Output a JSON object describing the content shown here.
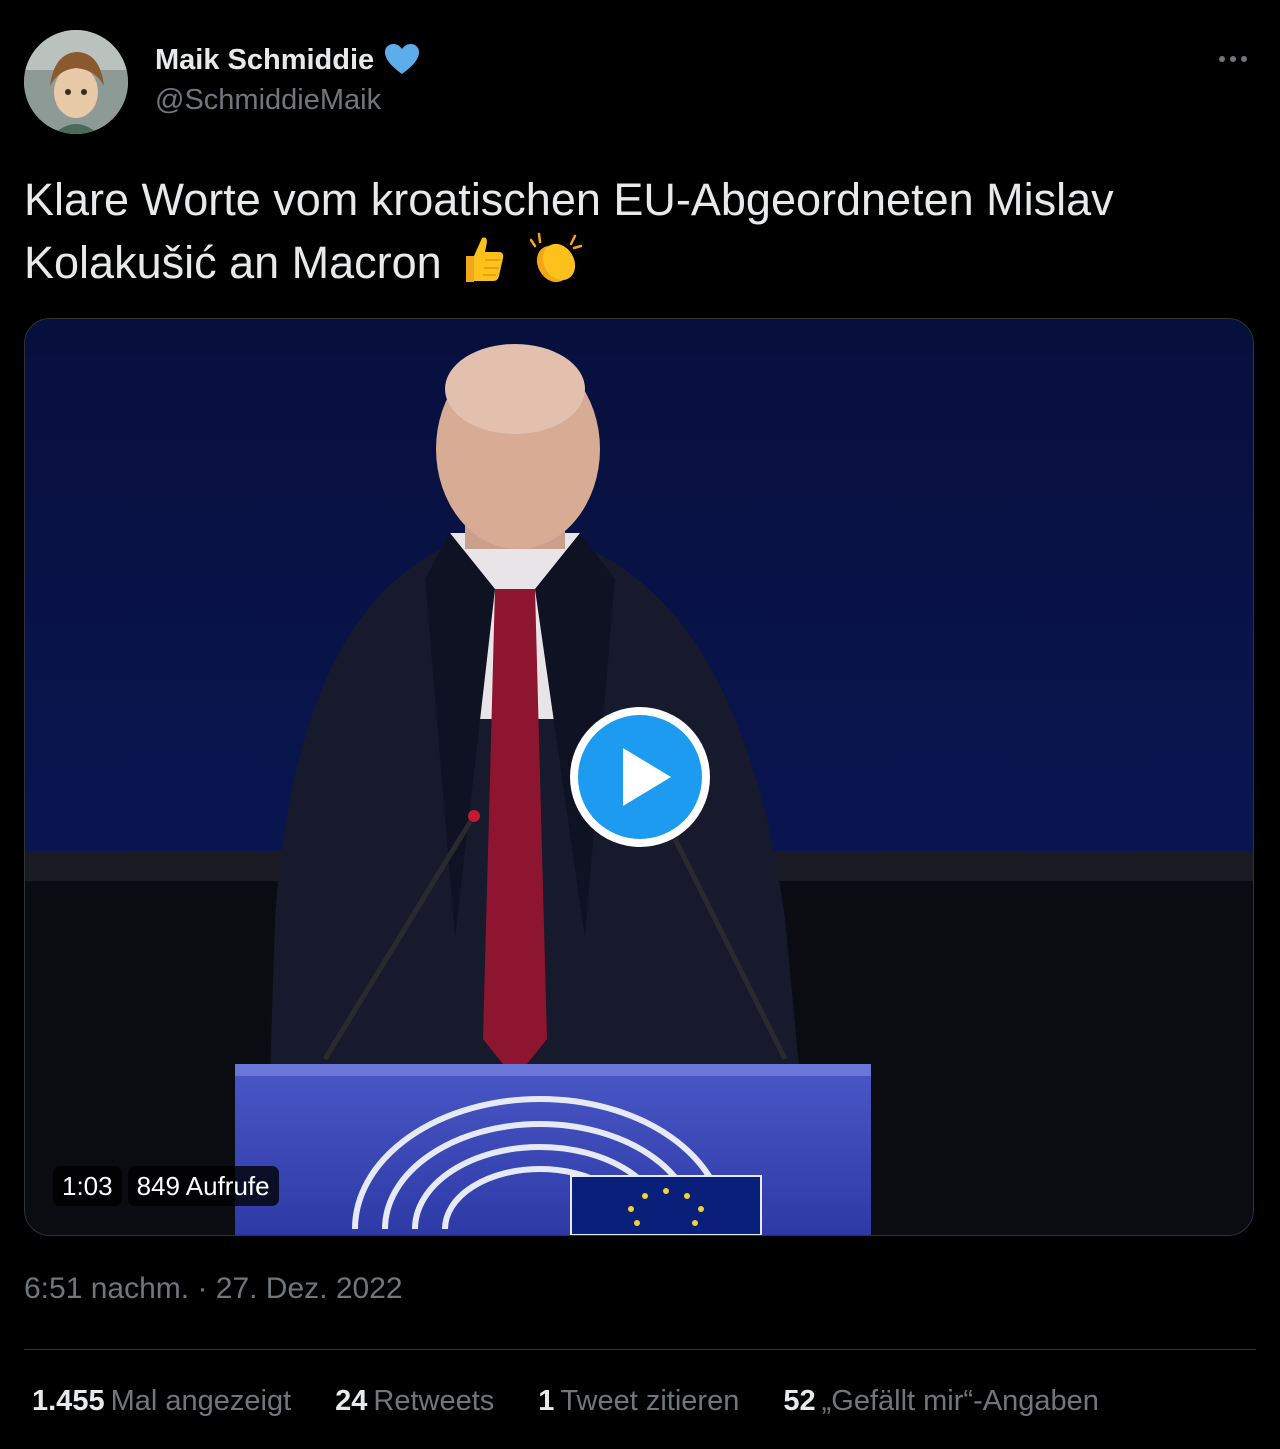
{
  "author": {
    "display_name": "Maik Schmiddie",
    "handle": "@SchmiddieMaik",
    "verified_icon": "blue-heart-icon"
  },
  "tweet": {
    "text": "Klare Worte vom kroatischen EU-Abgeordneten Mislav Kolakušić an Macron",
    "emojis": [
      "thumbs-up-icon",
      "clapping-hands-icon"
    ]
  },
  "video": {
    "duration": "1:03",
    "views": "849 Aufrufe",
    "play_icon": "play-icon"
  },
  "timestamp": "6:51 nachm. · 27. Dez. 2022",
  "stats": [
    {
      "num": "1.455",
      "label": "Mal angezeigt"
    },
    {
      "num": "24",
      "label": "Retweets"
    },
    {
      "num": "1",
      "label": "Tweet zitieren"
    },
    {
      "num": "52",
      "label": "„Gefällt mir“-Angaben"
    }
  ],
  "colors": {
    "background": "#000000",
    "text_primary": "#e7e9ea",
    "text_secondary": "#71767b",
    "accent": "#1d9bf0",
    "divider": "#2f3336"
  }
}
